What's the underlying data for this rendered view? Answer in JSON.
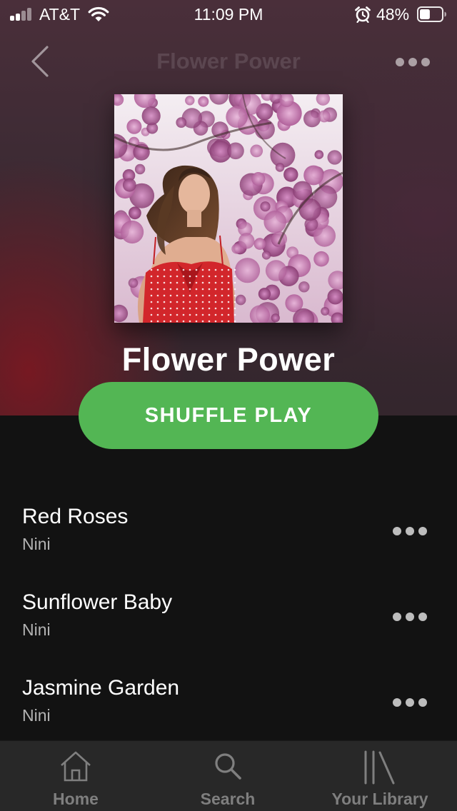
{
  "status_bar": {
    "carrier": "AT&T",
    "time": "11:09 PM",
    "battery_percent": "48%",
    "signal_bars_filled": 2,
    "signal_bars_total": 4,
    "battery_level": 0.48,
    "icons": [
      "signal-icon",
      "wifi-icon",
      "alarm-icon",
      "battery-icon"
    ]
  },
  "nav": {
    "title": "Flower Power",
    "back_icon": "chevron-left-icon",
    "more_icon": "more-horizontal-icon"
  },
  "playlist": {
    "title": "Flower Power",
    "shuffle_label": "SHUFFLE PLAY"
  },
  "tracks": [
    {
      "title": "Red Roses",
      "artist": "Nini"
    },
    {
      "title": "Sunflower Baby",
      "artist": "Nini"
    },
    {
      "title": "Jasmine Garden",
      "artist": "Nini"
    }
  ],
  "tabs": [
    {
      "label": "Home",
      "icon": "home-icon"
    },
    {
      "label": "Search",
      "icon": "search-icon"
    },
    {
      "label": "Your Library",
      "icon": "library-icon"
    }
  ],
  "colors": {
    "accent_green": "#53b654",
    "background": "#121212",
    "tab_bar": "#282828",
    "secondary_text": "#b3b3b3",
    "tab_inactive": "#7f7f7f"
  }
}
